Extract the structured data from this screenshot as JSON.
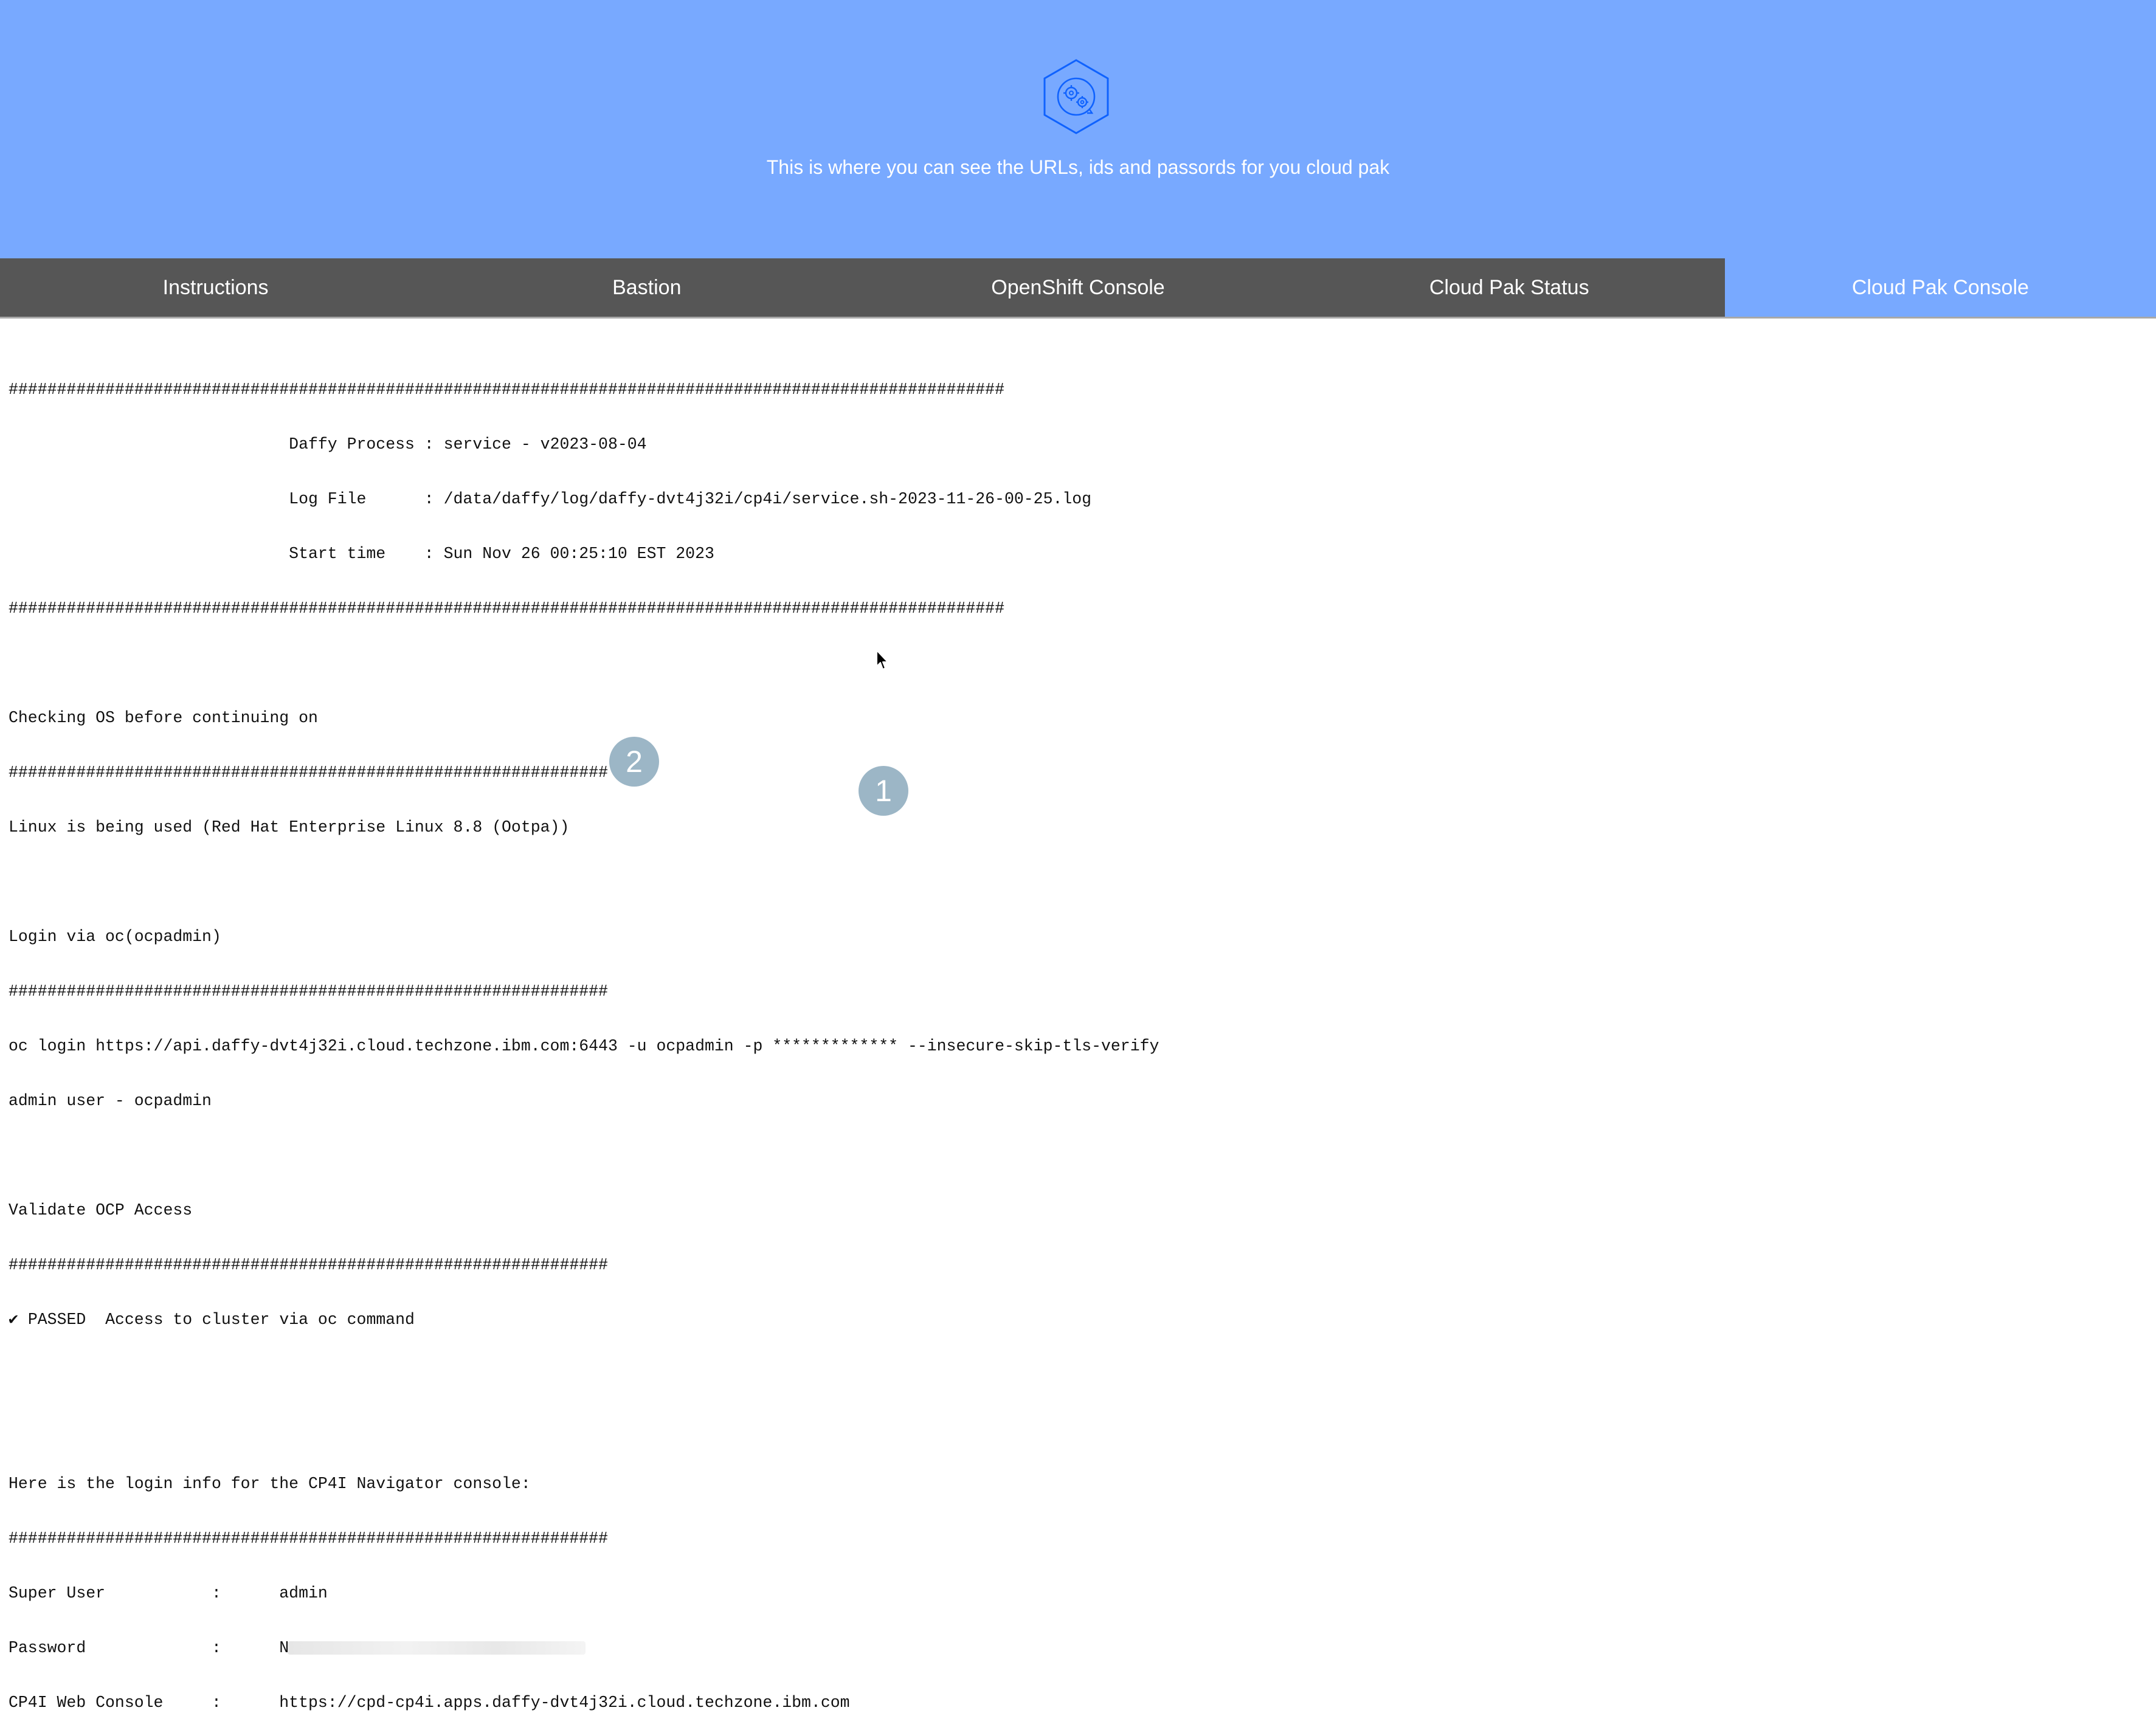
{
  "header": {
    "icon": "hexagon-gears-icon",
    "tagline": "This is where you can see the URLs, ids and passords for you cloud pak"
  },
  "tabs": [
    {
      "label": "Instructions",
      "active": false
    },
    {
      "label": "Bastion",
      "active": false
    },
    {
      "label": "OpenShift Console",
      "active": false
    },
    {
      "label": "Cloud Pak Status",
      "active": false
    },
    {
      "label": "Cloud Pak Console",
      "active": true
    }
  ],
  "console": {
    "lines": [
      "#######################################################################################################",
      "                             Daffy Process : service - v2023-08-04",
      "                             Log File      : /data/daffy/log/daffy-dvt4j32i/cp4i/service.sh-2023-11-26-00-25.log",
      "                             Start time    : Sun Nov 26 00:25:10 EST 2023",
      "#######################################################################################################",
      "",
      "Checking OS before continuing on",
      "##############################################################",
      "Linux is being used (Red Hat Enterprise Linux 8.8 (Ootpa))",
      "",
      "Login via oc(ocpadmin)",
      "##############################################################",
      "oc login https://api.daffy-dvt4j32i.cloud.techzone.ibm.com:6443 -u ocpadmin -p ************* --insecure-skip-tls-verify",
      "admin user - ocpadmin",
      "",
      "Validate OCP Access",
      "##############################################################",
      "✔ PASSED  Access to cluster via oc command",
      "",
      "",
      "Here is the login info for the CP4I Navigator console:",
      "##############################################################",
      "Super User           :      admin"
    ],
    "password_label": "Password             :      N",
    "web_console_label": "CP4I Web Console     :      ",
    "web_console_url": "https://cpd-cp4i.apps.daffy-dvt4j32i.cloud.techzone.ibm.com"
  },
  "annotations": {
    "badge_1": "1",
    "badge_2": "2"
  },
  "colors": {
    "hero_background": "#78a9ff",
    "tab_background": "#565656",
    "active_tab": "#78a9ff",
    "badge": "#9cb6c6"
  }
}
